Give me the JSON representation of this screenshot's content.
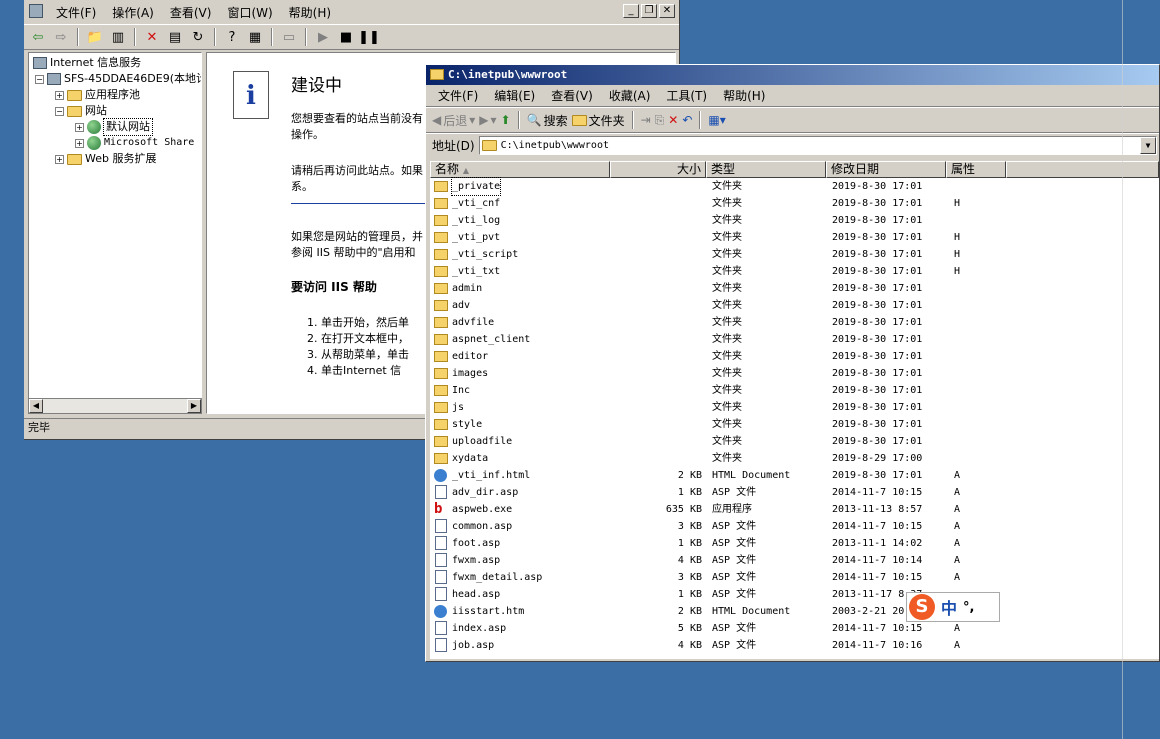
{
  "iis": {
    "menu": [
      "文件(F)",
      "操作(A)",
      "查看(V)",
      "窗口(W)",
      "帮助(H)"
    ],
    "tree": {
      "root": "Internet 信息服务",
      "server": "SFS-45DDAE46DE9(本地计",
      "app_pools": "应用程序池",
      "websites": "网站",
      "default_site": "默认网站",
      "sharepoint": "Microsoft Share",
      "web_ext": "Web 服务扩展"
    },
    "content": {
      "title": "建设中",
      "p1a": "您想要查看的站点当前没有",
      "p1b": "操作。",
      "p2a": "请稍后再访问此站点。如果",
      "p2b": "系。",
      "p3a": "如果您是网站的管理员，并",
      "p3b": "参阅 IIS 帮助中的\"启用和",
      "heading": "要访问 IIS 帮助",
      "steps": [
        "1.  单击开始，然后单",
        "2.  在打开文本框中，",
        "3.  从帮助菜单，单击",
        "4.  单击Internet 信"
      ]
    },
    "status": "完毕"
  },
  "explorer": {
    "title": "C:\\inetpub\\wwwroot",
    "menu": [
      "文件(F)",
      "编辑(E)",
      "查看(V)",
      "收藏(A)",
      "工具(T)",
      "帮助(H)"
    ],
    "toolbar": {
      "back": "后退",
      "search": "搜索",
      "folders": "文件夹"
    },
    "address_label": "地址(D)",
    "address_value": "C:\\inetpub\\wwwroot",
    "columns": {
      "name": "名称",
      "size": "大小",
      "type": "类型",
      "modified": "修改日期",
      "attr": "属性"
    },
    "files": [
      {
        "name": "_private",
        "size": "",
        "type": "文件夹",
        "date": "2019-8-30 17:01",
        "attr": "",
        "kind": "folder"
      },
      {
        "name": "_vti_cnf",
        "size": "",
        "type": "文件夹",
        "date": "2019-8-30 17:01",
        "attr": "H",
        "kind": "folder"
      },
      {
        "name": "_vti_log",
        "size": "",
        "type": "文件夹",
        "date": "2019-8-30 17:01",
        "attr": "",
        "kind": "folder"
      },
      {
        "name": "_vti_pvt",
        "size": "",
        "type": "文件夹",
        "date": "2019-8-30 17:01",
        "attr": "H",
        "kind": "folder"
      },
      {
        "name": "_vti_script",
        "size": "",
        "type": "文件夹",
        "date": "2019-8-30 17:01",
        "attr": "H",
        "kind": "folder"
      },
      {
        "name": "_vti_txt",
        "size": "",
        "type": "文件夹",
        "date": "2019-8-30 17:01",
        "attr": "H",
        "kind": "folder"
      },
      {
        "name": "admin",
        "size": "",
        "type": "文件夹",
        "date": "2019-8-30 17:01",
        "attr": "",
        "kind": "folder"
      },
      {
        "name": "adv",
        "size": "",
        "type": "文件夹",
        "date": "2019-8-30 17:01",
        "attr": "",
        "kind": "folder"
      },
      {
        "name": "advfile",
        "size": "",
        "type": "文件夹",
        "date": "2019-8-30 17:01",
        "attr": "",
        "kind": "folder"
      },
      {
        "name": "aspnet_client",
        "size": "",
        "type": "文件夹",
        "date": "2019-8-30 17:01",
        "attr": "",
        "kind": "folder"
      },
      {
        "name": "editor",
        "size": "",
        "type": "文件夹",
        "date": "2019-8-30 17:01",
        "attr": "",
        "kind": "folder"
      },
      {
        "name": "images",
        "size": "",
        "type": "文件夹",
        "date": "2019-8-30 17:01",
        "attr": "",
        "kind": "folder"
      },
      {
        "name": "Inc",
        "size": "",
        "type": "文件夹",
        "date": "2019-8-30 17:01",
        "attr": "",
        "kind": "folder"
      },
      {
        "name": "js",
        "size": "",
        "type": "文件夹",
        "date": "2019-8-30 17:01",
        "attr": "",
        "kind": "folder"
      },
      {
        "name": "style",
        "size": "",
        "type": "文件夹",
        "date": "2019-8-30 17:01",
        "attr": "",
        "kind": "folder"
      },
      {
        "name": "uploadfile",
        "size": "",
        "type": "文件夹",
        "date": "2019-8-30 17:01",
        "attr": "",
        "kind": "folder"
      },
      {
        "name": "xydata",
        "size": "",
        "type": "文件夹",
        "date": "2019-8-29 17:00",
        "attr": "",
        "kind": "folder"
      },
      {
        "name": "_vti_inf.html",
        "size": "2 KB",
        "type": "HTML Document",
        "date": "2019-8-30 17:01",
        "attr": "A",
        "kind": "html"
      },
      {
        "name": "adv_dir.asp",
        "size": "1 KB",
        "type": "ASP 文件",
        "date": "2014-11-7 10:15",
        "attr": "A",
        "kind": "file"
      },
      {
        "name": "aspweb.exe",
        "size": "635 KB",
        "type": "应用程序",
        "date": "2013-11-13 8:57",
        "attr": "A",
        "kind": "exe"
      },
      {
        "name": "common.asp",
        "size": "3 KB",
        "type": "ASP 文件",
        "date": "2014-11-7 10:15",
        "attr": "A",
        "kind": "file"
      },
      {
        "name": "foot.asp",
        "size": "1 KB",
        "type": "ASP 文件",
        "date": "2013-11-1 14:02",
        "attr": "A",
        "kind": "file"
      },
      {
        "name": "fwxm.asp",
        "size": "4 KB",
        "type": "ASP 文件",
        "date": "2014-11-7 10:14",
        "attr": "A",
        "kind": "file"
      },
      {
        "name": "fwxm_detail.asp",
        "size": "3 KB",
        "type": "ASP 文件",
        "date": "2014-11-7 10:15",
        "attr": "A",
        "kind": "file"
      },
      {
        "name": "head.asp",
        "size": "1 KB",
        "type": "ASP 文件",
        "date": "2013-11-17 8:37",
        "attr": "",
        "kind": "file"
      },
      {
        "name": "iisstart.htm",
        "size": "2 KB",
        "type": "HTML Document",
        "date": "2003-2-21 20:",
        "attr": "",
        "kind": "html"
      },
      {
        "name": "index.asp",
        "size": "5 KB",
        "type": "ASP 文件",
        "date": "2014-11-7 10:15",
        "attr": "A",
        "kind": "file"
      },
      {
        "name": "job.asp",
        "size": "4 KB",
        "type": "ASP 文件",
        "date": "2014-11-7 10:16",
        "attr": "A",
        "kind": "file"
      }
    ]
  },
  "ime": {
    "logo": "S",
    "mode": "中",
    "punct": "°,"
  }
}
